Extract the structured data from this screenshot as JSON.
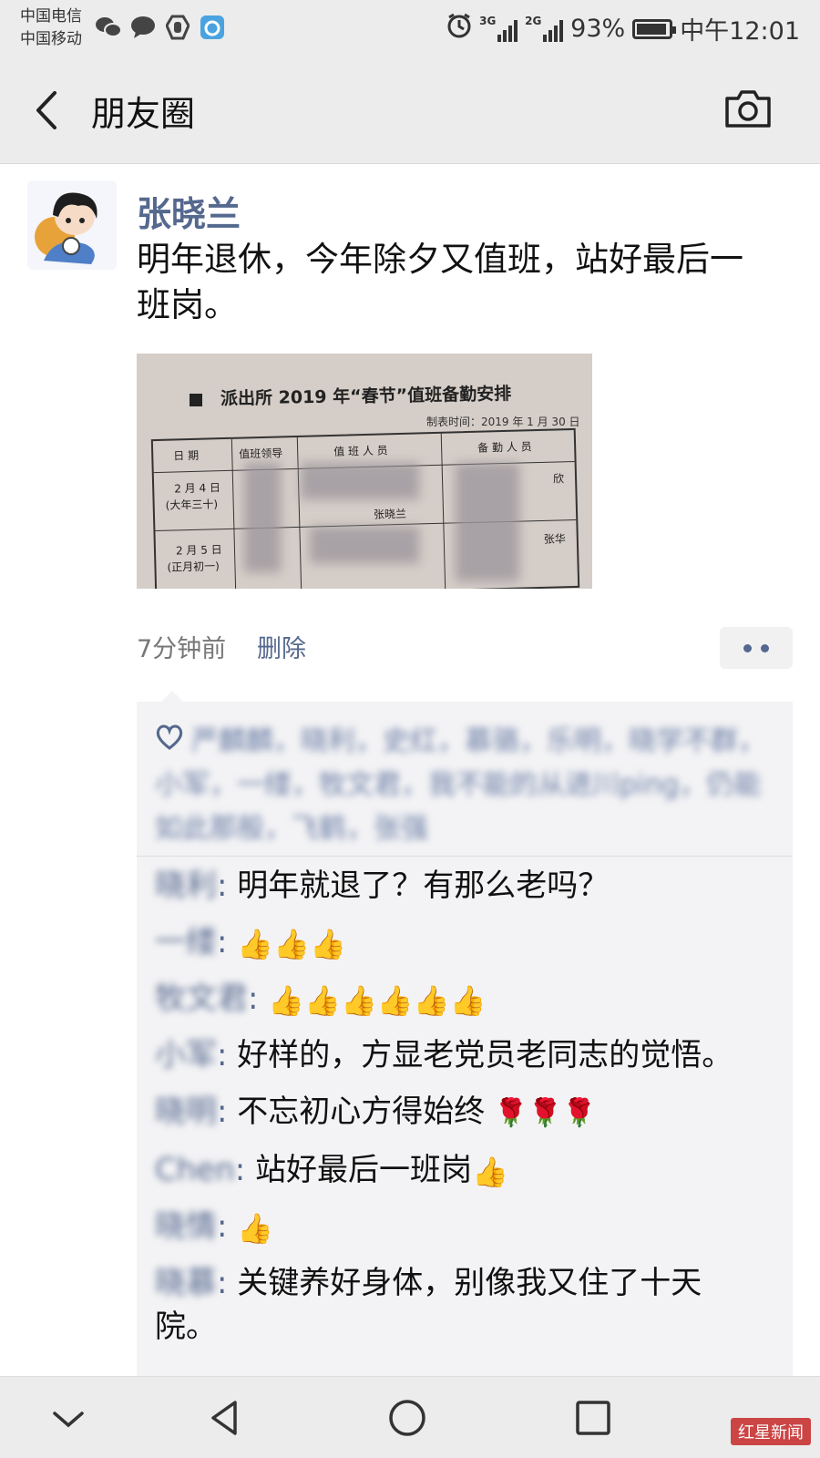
{
  "status_bar": {
    "carrier_1": "中国电信",
    "carrier_2": "中国移动",
    "net_1": "3G",
    "net_2": "2G",
    "battery": "93%",
    "time": "中午12:01",
    "icons": [
      "wechat-icon",
      "chat-bubble-icon",
      "shield-hand-icon",
      "app-icon",
      "alarm-icon"
    ]
  },
  "header": {
    "title": "朋友圈",
    "back_icon": "chevron-left-icon",
    "camera_icon": "camera-icon"
  },
  "post": {
    "author": "张晓兰",
    "text": "明年退休，今年除夕又值班，站好最后一班岗。",
    "image": {
      "doc_title": "派出所 2019 年“春节”值班备勤安排",
      "doc_date": "制表时间：2019 年 1 月 30 日",
      "headers": [
        "日 期",
        "值班领导",
        "值 班 人 员",
        "备 勤 人 员"
      ],
      "row1_date": "2 月 4 日",
      "row1_note": "(大年三十)",
      "row2_date": "2 月 5 日",
      "row2_note": "(正月初一)",
      "visible_name": "张晓兰",
      "visible_fragment_1": "欣",
      "visible_fragment_2": "张华"
    },
    "time": "7分钟前",
    "delete_label": "删除"
  },
  "likes": {
    "icon": "heart-icon",
    "blurred_names": "严麟麟，晓利，史红，慕骆，乐明，晓学不群，小军，一缕，牧文君，我不能的从进川ping，仍能如此那般，飞鹤，张强"
  },
  "comments": [
    {
      "name": "晓利",
      "text": "明年就退了？有那么老吗？",
      "emoji": ""
    },
    {
      "name": "一缕",
      "text": "",
      "emoji": "👍👍👍"
    },
    {
      "name": "牧文君",
      "text": "",
      "emoji": "👍👍👍👍👍👍"
    },
    {
      "name": "小军",
      "text": "好样的，方显老党员老同志的觉悟。",
      "emoji": ""
    },
    {
      "name": "晓明",
      "text": "不忘初心方得始终",
      "emoji": "🌹🌹🌹"
    },
    {
      "name": "Chen",
      "text": "站好最后一班岗",
      "emoji": "👍"
    },
    {
      "name": "晓情",
      "text": "",
      "emoji": "👍"
    },
    {
      "name": "晓慕",
      "text": "关键养好身体，别像我又住了十天院。",
      "emoji": ""
    }
  ],
  "nav": {
    "icons": [
      "chevron-down-icon",
      "back-triangle-icon",
      "home-circle-icon",
      "recents-square-icon"
    ]
  },
  "watermark": "红星新闻",
  "colors": {
    "name_blue": "#55688e",
    "bar_gray": "#ececec",
    "comment_bg": "#f3f3f5"
  }
}
